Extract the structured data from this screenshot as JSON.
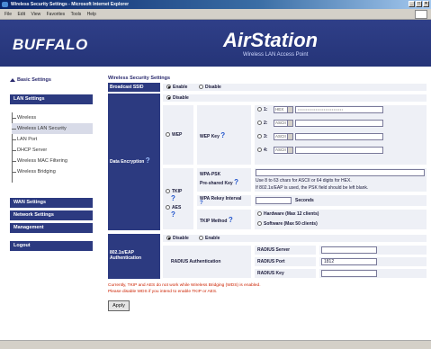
{
  "window": {
    "title": "Wireless Security Settings - Microsoft Internet Explorer",
    "menus": [
      "File",
      "Edit",
      "View",
      "Favorites",
      "Tools",
      "Help"
    ]
  },
  "header": {
    "logo": "BUFFALO",
    "product": "AirStation",
    "subtitle": "Wireless LAN Access Point"
  },
  "sidebar": {
    "basic_settings": "Basic Settings",
    "lan_settings": "LAN Settings",
    "sub_items": [
      "Wireless",
      "Wireless LAN Security",
      "LAN Port",
      "DHCP Server",
      "Wireless MAC Filtering",
      "Wireless Bridging"
    ],
    "wan_settings": "WAN Settings",
    "network_settings": "Network Settings",
    "management": "Management",
    "logout": "Logout"
  },
  "main": {
    "section_title": "Wireless Security Settings",
    "broadcast_ssid": {
      "label": "Broadcast SSID",
      "enable": "Enable",
      "disable": "Disable",
      "selected": "Enable"
    },
    "data_encryption": {
      "label": "Data Encryption",
      "disable": "Disable",
      "wep": "WEP",
      "wep_key": "WEP Key",
      "keys": [
        {
          "num": "1:",
          "type": "HEX"
        },
        {
          "num": "2:",
          "type": "ASCII"
        },
        {
          "num": "3:",
          "type": "ASCII"
        },
        {
          "num": "4:",
          "type": "ASCII"
        }
      ],
      "tkip": "TKIP",
      "aes": "AES",
      "wpa_psk_label": "WPA-PSK",
      "preshared_key": "Pre-shared Key",
      "psk_hint_1": "Use 8 to 63 chars for ASCII or 64 digits for HEX.",
      "psk_hint_2": "If 802.1x/EAP is used, the PSK field should be left blank.",
      "rekey_label": "WPA Rekey Interval",
      "rekey_units": "Seconds",
      "tkip_method": "TKIP Method",
      "hardware": "Hardware (Max 12 clients)",
      "software": "Software (Max 50 clients)"
    },
    "eap": {
      "label": "802.1x/EAP Authentication",
      "disable": "Disable",
      "enable": "Enable",
      "radius_auth": "RADIUS Authentication",
      "server_label": "RADIUS Server",
      "port_label": "RADIUS Port",
      "port_value": "1812",
      "key_label": "RADIUS Key"
    },
    "warning_1": "Currently, TKIP and AES do not work while Wireless Bridging (WDS) is enabled.",
    "warning_2": "Please disable WDS if you intend to enable TKIP or AES.",
    "apply": "Apply"
  }
}
